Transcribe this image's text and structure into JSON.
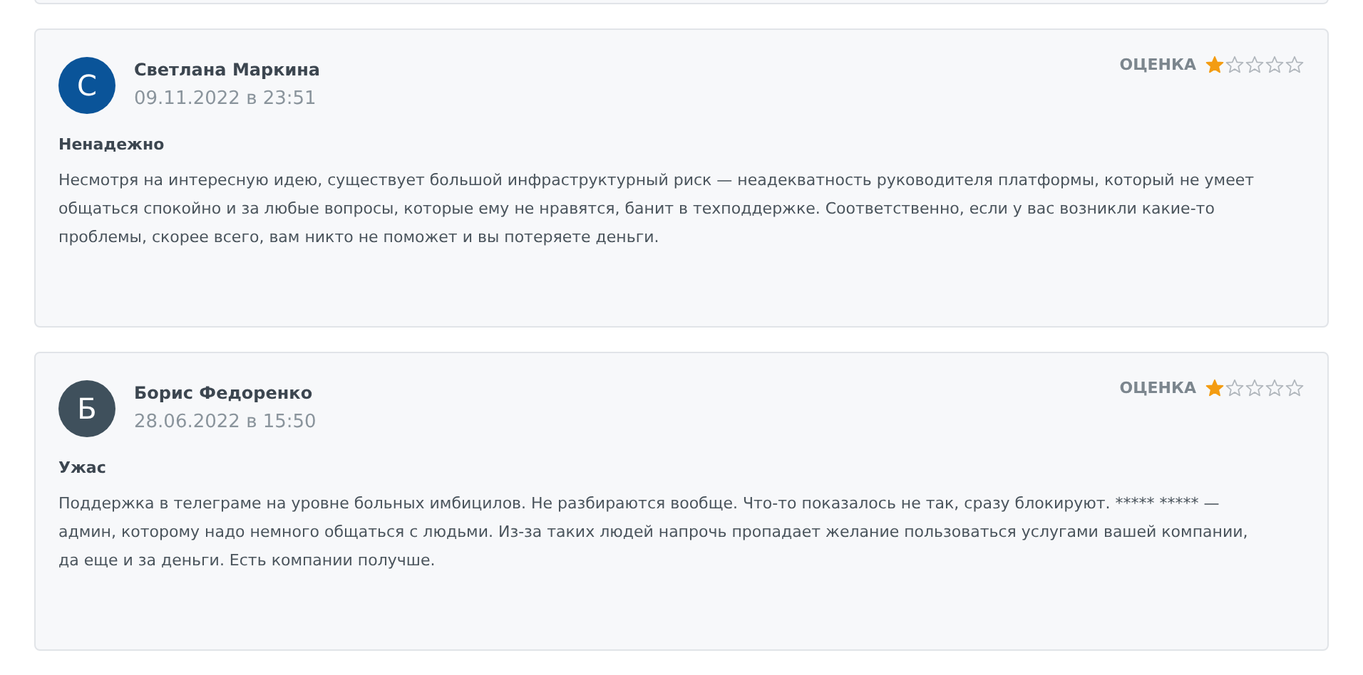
{
  "reviews": [
    {
      "initial": "С",
      "color": "#0a5499",
      "name": "Светлана Маркина",
      "date": "09.11.2022 в 23:51",
      "rating_label": "ОЦЕНКА",
      "stars": 1,
      "title": "Ненадежно",
      "text": "Несмотря на интересную идею, существует большой инфраструктурный риск — неадекватность руководителя платформы, который не умеет общаться спокойно и за любые вопросы, которые ему не нравятся, банит в техподдержке. Соответственно, если у вас возникли какие-то проблемы, скорее всего, вам никто не поможет и вы потеряете деньги."
    },
    {
      "initial": "Б",
      "color": "#3f505c",
      "name": "Борис Федоренко",
      "date": "28.06.2022 в 15:50",
      "rating_label": "ОЦЕНКА",
      "stars": 1,
      "title": "Ужас",
      "text": "Поддержка в телеграме на уровне больных имбицилов. Не разбираются вообще. Что-то показалось не так, сразу блокируют. ***** ***** — админ, которому надо немного общаться с людьми. Из-за таких людей напрочь пропадает желание пользоваться услугами вашей компании, да еще и за деньги. Есть компании получше."
    }
  ]
}
